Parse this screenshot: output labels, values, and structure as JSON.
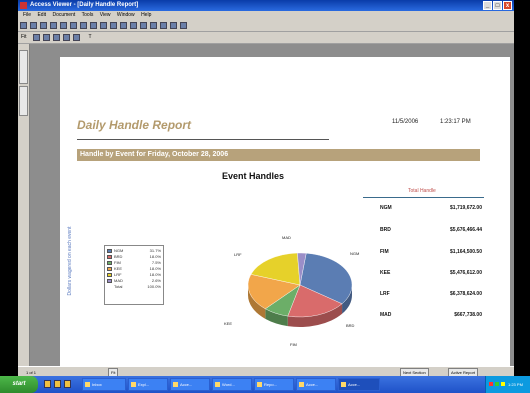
{
  "window": {
    "title": "Access Viewer - [Daily Handle Report]",
    "buttons": [
      "_",
      "□",
      "x"
    ]
  },
  "menu": [
    "File",
    "Edit",
    "Document",
    "Tools",
    "View",
    "Window",
    "Help"
  ],
  "toolbar2": {
    "zoom": "Fit",
    "text": "T"
  },
  "report": {
    "title": "Daily Handle Report",
    "date": "11/5/2006",
    "time": "1:23:17 PM",
    "band": "Handle by Event for Friday, October 28, 2006",
    "chart_title": "Event Handles",
    "y_axis_label": "Dollars wagered on each event",
    "legend": [
      {
        "code": "NGM",
        "value": "31.7%",
        "color": "#5b7db3"
      },
      {
        "code": "BRD",
        "value": "18.0%",
        "color": "#d96b6b"
      },
      {
        "code": "FIM",
        "value": "7.5%",
        "color": "#6cae68"
      },
      {
        "code": "KEE",
        "value": "18.0%",
        "color": "#f2a64a"
      },
      {
        "code": "LRF",
        "value": "18.0%",
        "color": "#e6d12a"
      },
      {
        "code": "MAD",
        "value": "2.6%",
        "color": "#9b8ec8"
      },
      {
        "code": "Total",
        "value": "100.0%",
        "color": ""
      }
    ],
    "pie_labels": [
      "NGM",
      "BRD",
      "FIM",
      "KEE",
      "LRF",
      "MAD"
    ],
    "table_header": "Total Handle",
    "table_rows": [
      {
        "code": "NGM",
        "value": "$1,719,672.00"
      },
      {
        "code": "BRD",
        "value": "$5,676,466.44"
      },
      {
        "code": "FIM",
        "value": "$1,164,500.50"
      },
      {
        "code": "KEE",
        "value": "$5,476,612.00"
      },
      {
        "code": "LRF",
        "value": "$6,378,624.00"
      },
      {
        "code": "MAD",
        "value": "$667,738.00"
      }
    ]
  },
  "chart_data": {
    "type": "pie",
    "title": "Event Handles",
    "categories": [
      "NGM",
      "BRD",
      "FIM",
      "KEE",
      "LRF",
      "MAD"
    ],
    "values": [
      31.7,
      18.0,
      7.5,
      18.0,
      18.0,
      2.6
    ],
    "colors": [
      "#5b7db3",
      "#d96b6b",
      "#6cae68",
      "#f2a64a",
      "#e6d12a",
      "#9b8ec8"
    ],
    "legend_position": "left"
  },
  "statusbar": {
    "page": "1 of 1",
    "zoom": "Fit",
    "right1": "Next Section",
    "right2": "Active Report"
  },
  "taskbar": {
    "start": "start",
    "tasks": [
      "Inbox",
      "Expl...",
      "Acce...",
      "Word...",
      "Repo...",
      "Acce...",
      "Acce..."
    ],
    "clock": "1:23 PM"
  }
}
